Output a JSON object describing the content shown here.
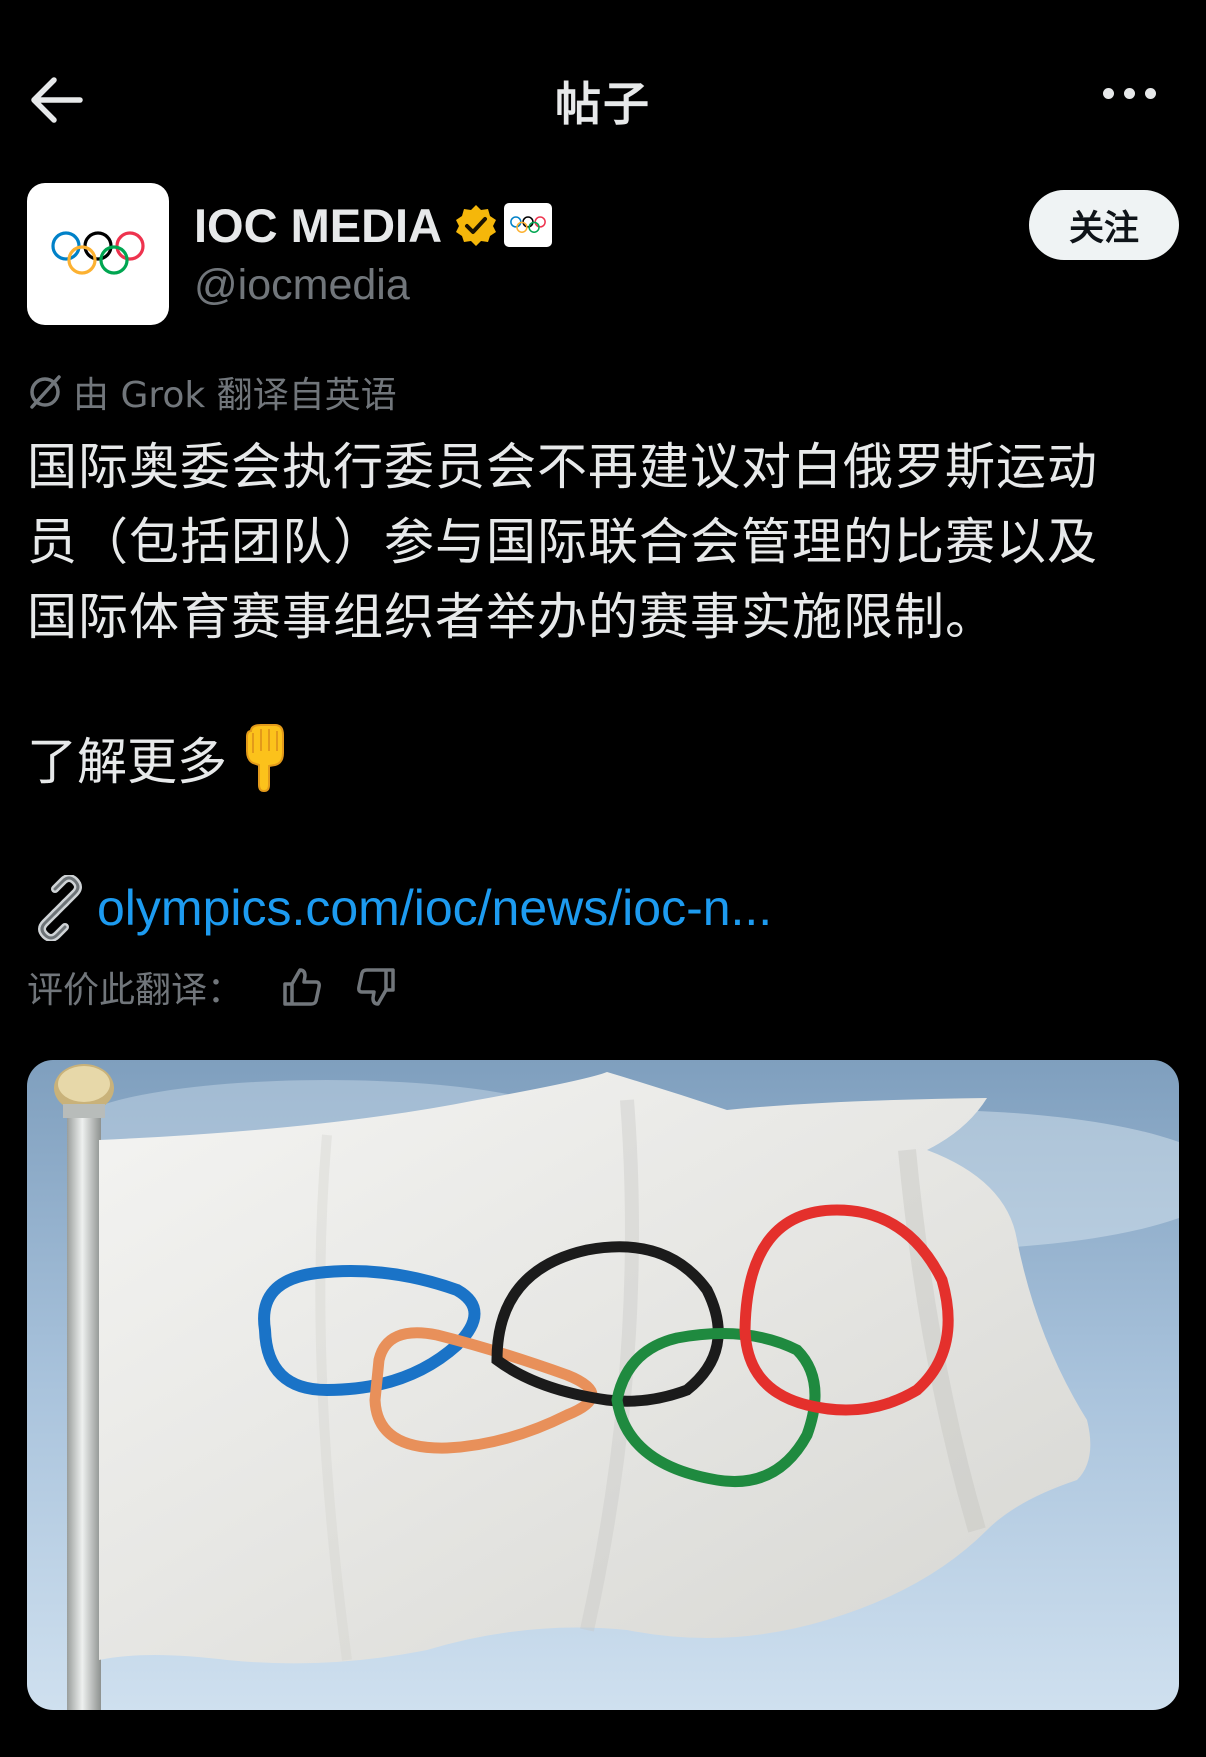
{
  "header": {
    "title": "帖子"
  },
  "author": {
    "display_name": "IOC MEDIA",
    "handle": "@iocmedia",
    "follow_label": "关注"
  },
  "translation": {
    "note": "由 Grok 翻译自英语",
    "rate_label": "评价此翻译："
  },
  "post": {
    "lines": [
      "国际奥委会执行委员会不再建议对白俄罗斯运动",
      "员（包括团队）参与国际联合会管理的比赛以及",
      "国际体育赛事组织者举办的赛事实施限制。"
    ],
    "learn_more": "了解更多",
    "link_text": "olympics.com/ioc/news/ioc-n..."
  },
  "colors": {
    "background": "#000000",
    "text": "#e7e9ea",
    "muted": "#71767b",
    "link": "#1d9bf0",
    "verified_gold": "#f5b70a",
    "ring_blue": "#0081c8",
    "ring_yellow": "#fcb131",
    "ring_black": "#000000",
    "ring_green": "#00a651",
    "ring_red": "#ee334e"
  },
  "icons": {
    "back": "arrow-left-icon",
    "more": "more-horizontal-icon",
    "verified": "verified-badge-icon",
    "affiliate": "olympic-rings-icon",
    "translate": "translate-icon",
    "link": "link-icon",
    "thumbs_up": "thumbs-up-icon",
    "thumbs_down": "thumbs-down-icon",
    "emoji": "pointing-down-emoji"
  }
}
